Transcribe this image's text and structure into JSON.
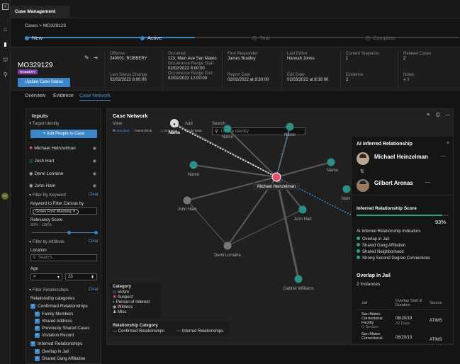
{
  "app": {
    "tab": "Case Management"
  },
  "breadcrumb": {
    "root": "Cases",
    "sep": ">",
    "current": "MO329129"
  },
  "stages": [
    {
      "label": "New",
      "done": true
    },
    {
      "label": "Active",
      "done": true
    },
    {
      "label": "Trial",
      "done": false
    },
    {
      "label": "Complete",
      "done": false
    }
  ],
  "case": {
    "id": "MO329129",
    "badge": "ROBBERY",
    "update_button": "Update Case Status",
    "fields": {
      "offense_l": "Offense",
      "offense_v": "240001: ROBBERY",
      "lsc_l": "Last Status Change",
      "lsc_v": "02/02/2022 8:00:00",
      "occurred_l": "Occurred",
      "occurred_v": "123, Main Ave San Mateo",
      "ors_l": "Occurrence Range Start",
      "ors_v": "02/02/2022 8:00:00",
      "ore_l": "Occurrence Range End",
      "ore_v": "02/02/2022 12:00:00",
      "fr_l": "First Responder",
      "fr_v": "James Bradley",
      "rd_l": "Report Date",
      "rd_v": "02/02/2022 at 8:30:00",
      "le_l": "Last Editor",
      "le_v": "Hannah Jones",
      "ed_l": "Edit Date",
      "ed_v": "02/03/2022 at 8:30:00",
      "cs_l": "Current Suspects",
      "cs_v": "1",
      "ev_l": "Evidence",
      "ev_v": "2",
      "rc_l": "Related Cases",
      "rc_v": "2",
      "no_l": "Notes",
      "no_v": "● 3"
    }
  },
  "subtabs": [
    "Overview",
    "Evidence",
    "Case Network"
  ],
  "inputs": {
    "title": "Inputs",
    "target_identity": "Target Identity",
    "add_button": "+ Add People to Case",
    "people": [
      "Michael Heinzelman",
      "Josh Hart",
      "Demi Lorraine",
      "John Ham"
    ],
    "filter_keyword": "Filter By Keyword",
    "clear": "Clear",
    "keyword_label": "Keyword to Filter Canvas by",
    "keyword_chip": "Green Ford Mustang",
    "relevancy_label": "Relevancy Score",
    "relevancy_range": "60% - 100%",
    "filter_attribute": "Filter by Attribute",
    "location_label": "Location",
    "location_placeholder": "Search...",
    "age_label": "Age",
    "age_op": ">",
    "age_val": "23",
    "filter_rel": "Filter Relationships",
    "rel_categories": "Relationship categories",
    "confirmed": "Confirmed Relationships",
    "confirmed_items": [
      "Family Members",
      "Shared Address",
      "Previously Shared Cases",
      "Visitation Record"
    ],
    "inferred": "Inferred Relationships",
    "inferred_items": [
      "Overlap in Jail",
      "Shared Gang Affiliation"
    ]
  },
  "network": {
    "title": "Case Network",
    "view": "View",
    "add": "Add",
    "search": "Search",
    "view_opts": [
      "Standard",
      "Hierarchical",
      "Grouping"
    ],
    "add_opt": "Add Data",
    "search_placeholder": "Locate Identity",
    "nodes": {
      "center": "Michael Heinzelman",
      "n1": "Name",
      "n2": "Name",
      "n3": "Name",
      "n4": "Name",
      "n5": "Name",
      "n6": "Nam",
      "john": "John Ham",
      "josh": "Josh Hart",
      "demi": "Demi Lorraine",
      "gabriel": "Gabriel Williams"
    },
    "legend": {
      "category": "Category",
      "items": [
        "Victim",
        "Suspect",
        "Person of Interest",
        "Witness",
        "Misc"
      ],
      "rel_category": "Relationship Category",
      "confirmed": "Confirmed Relationships",
      "inferred": "Inferred Relationships"
    }
  },
  "ai": {
    "title": "AI Inferred Relationship",
    "person1": "Michael Heinzelman",
    "person2": "Gilbert Arenas",
    "score_title": "Inferred Relationship Score",
    "score": 0.93,
    "score_text": "93%",
    "indicators_title": "AI Inferred Relationship Indicators",
    "indicators": [
      "Overlap in Jail",
      "Shared Gang Affiliation",
      "Shared Neighborhood",
      "Strong Second Degree Connections"
    ],
    "overlap_title": "Overlap In Jail",
    "instances": "2 Instances",
    "col_jail": "Jail",
    "col_overlap": "Overlap Start & Duration",
    "col_source": "Source",
    "rows": [
      {
        "jail": "San Mateo Correctional Facility",
        "section": "O Section",
        "date": "08/20/19",
        "dur": "32 Days",
        "src": "ATIMS"
      },
      {
        "jail": "San Mateo Correctional",
        "section": "",
        "date": "08/20/13",
        "dur": "",
        "src": "ATIMS"
      }
    ]
  },
  "colors": {
    "accent": "#3d86c6",
    "suspect": "#e0566e",
    "green": "#2aa08a",
    "teal": "#2e8d86"
  }
}
